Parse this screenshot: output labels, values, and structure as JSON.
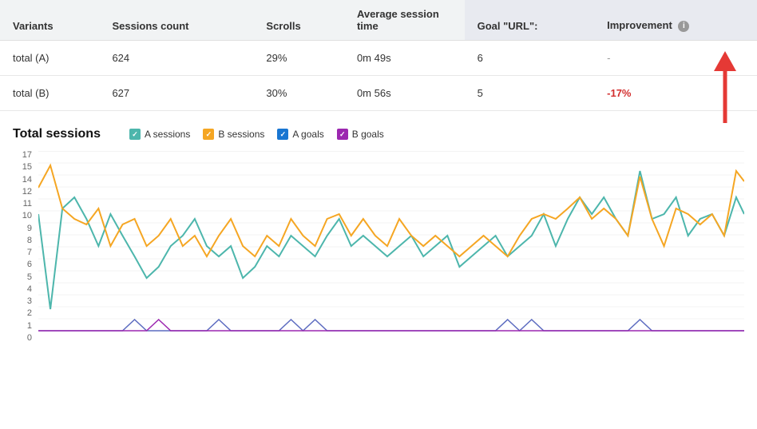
{
  "table": {
    "headers": [
      "Variants",
      "Sessions count",
      "Scrolls",
      "Average session time",
      "Goal \"URL\":",
      "Improvement"
    ],
    "rows": [
      {
        "variant": "total (A)",
        "sessions_count": "624",
        "scrolls": "29%",
        "avg_session_time": "0m 49s",
        "goal": "6",
        "improvement": "-",
        "improvement_type": "dash"
      },
      {
        "variant": "total (B)",
        "sessions_count": "627",
        "scrolls": "30%",
        "avg_session_time": "0m 56s",
        "goal": "5",
        "improvement": "-17%",
        "improvement_type": "negative"
      }
    ]
  },
  "chart": {
    "title": "Total sessions",
    "legend": [
      {
        "label": "A sessions",
        "color": "#4db6ac",
        "type": "check"
      },
      {
        "label": "B sessions",
        "color": "#f5a623",
        "type": "check"
      },
      {
        "label": "A goals",
        "color": "#1976d2",
        "type": "check"
      },
      {
        "label": "B goals",
        "color": "#9c27b0",
        "type": "check"
      }
    ],
    "y_labels": [
      "17",
      "15",
      "14",
      "12",
      "11",
      "10",
      "9",
      "8",
      "7",
      "6",
      "5",
      "4",
      "3",
      "2",
      "1",
      "0"
    ],
    "y_axis_values": [
      17,
      15,
      14,
      12,
      11,
      10,
      9,
      8,
      7,
      6,
      5,
      4,
      3,
      2,
      1,
      0
    ]
  }
}
